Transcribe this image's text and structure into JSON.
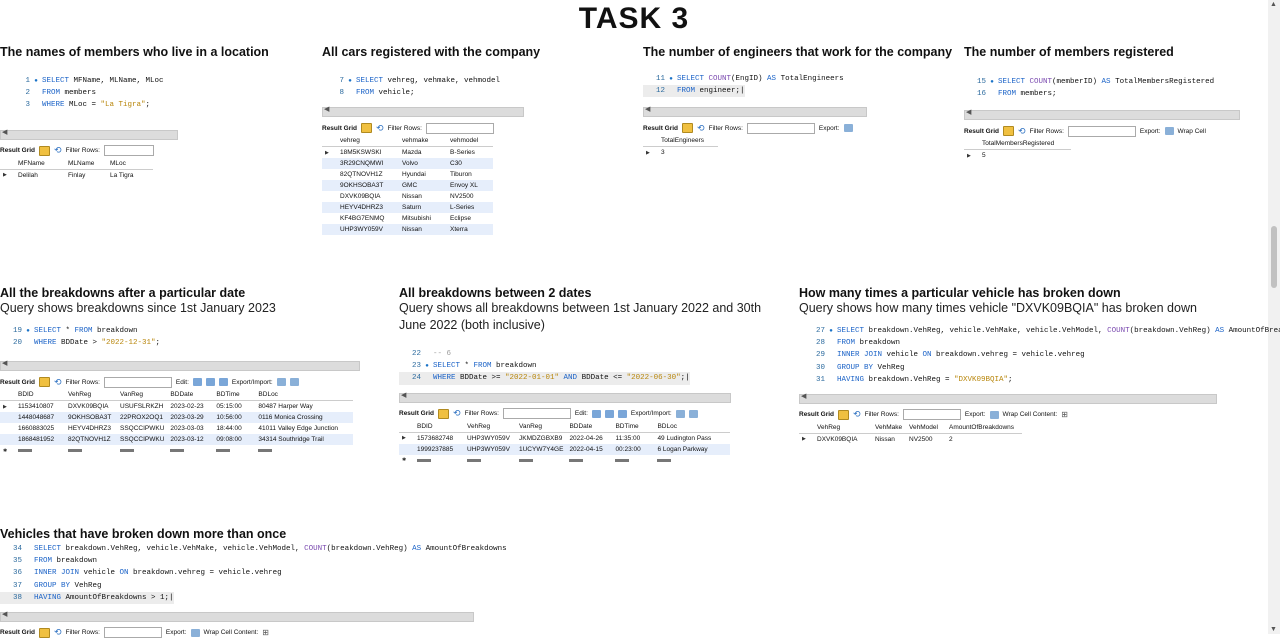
{
  "page": {
    "title": "TASK 3"
  },
  "panels": {
    "p1": {
      "title": "The names of members who live in a location",
      "code": [
        {
          "n": "1",
          "dot": true,
          "segs": [
            [
              "kw",
              "SELECT "
            ],
            [
              "",
              "MFName, MLName, MLoc"
            ]
          ]
        },
        {
          "n": "2",
          "dot": false,
          "segs": [
            [
              "kw",
              "FROM "
            ],
            [
              "",
              "members"
            ]
          ]
        },
        {
          "n": "3",
          "dot": false,
          "segs": [
            [
              "kw",
              "WHERE "
            ],
            [
              "",
              "MLoc = "
            ],
            [
              "st",
              "\"La Tigra\""
            ],
            [
              "",
              ";"
            ]
          ]
        }
      ],
      "toolbar": [
        "Result Grid",
        "Filter Rows:"
      ],
      "columns": [
        "MFName",
        "MLName",
        "MLoc"
      ],
      "rows": [
        [
          "Delilah",
          "Finlay",
          "La Tigra"
        ]
      ]
    },
    "p2": {
      "title": "All cars registered with the company",
      "code": [
        {
          "n": "7",
          "dot": true,
          "segs": [
            [
              "kw",
              "SELECT "
            ],
            [
              "",
              "vehreg, vehmake, vehmodel"
            ]
          ]
        },
        {
          "n": "8",
          "dot": false,
          "segs": [
            [
              "kw",
              "FROM "
            ],
            [
              "",
              "vehicle;"
            ]
          ]
        }
      ],
      "toolbar": [
        "Result Grid",
        "Filter Rows:"
      ],
      "columns": [
        "vehreg",
        "vehmake",
        "vehmodel"
      ],
      "rows": [
        [
          "18M5KSWSKI",
          "Mazda",
          "B-Series"
        ],
        [
          "3R29CNQMWI",
          "Volvo",
          "C30"
        ],
        [
          "82QTNOVH1Z",
          "Hyundai",
          "Tiburon"
        ],
        [
          "9OKHSOBA3T",
          "GMC",
          "Envoy XL"
        ],
        [
          "DXVK09BQIA",
          "Nissan",
          "NV2500"
        ],
        [
          "HEYV4DHRZ3",
          "Saturn",
          "L-Series"
        ],
        [
          "KF4BG7ENMQ",
          "Mitsubishi",
          "Eclipse"
        ],
        [
          "UHP3WY059V",
          "Nissan",
          "Xterra"
        ]
      ]
    },
    "p3": {
      "title": "The number of engineers that work for the company",
      "code": [
        {
          "n": "11",
          "dot": true,
          "segs": [
            [
              "kw",
              "SELECT "
            ],
            [
              "fn",
              "COUNT"
            ],
            [
              "",
              "(EngID) "
            ],
            [
              "kw",
              "AS "
            ],
            [
              "",
              "TotalEngineers"
            ]
          ]
        },
        {
          "n": "12",
          "dot": false,
          "cur": true,
          "segs": [
            [
              "kw",
              "FROM "
            ],
            [
              "",
              "engineer;"
            ]
          ]
        }
      ],
      "toolbar": [
        "Result Grid",
        "Filter Rows:",
        "Export:"
      ],
      "columns": [
        "TotalEngineers"
      ],
      "rows": [
        [
          "3"
        ]
      ]
    },
    "p4": {
      "title": "The number of members registered",
      "code": [
        {
          "n": "15",
          "dot": true,
          "segs": [
            [
              "kw",
              "SELECT "
            ],
            [
              "fn",
              "COUNT"
            ],
            [
              "",
              "(memberID) "
            ],
            [
              "kw",
              "AS "
            ],
            [
              "",
              "TotalMembersRegistered"
            ]
          ]
        },
        {
          "n": "16",
          "dot": false,
          "segs": [
            [
              "kw",
              "FROM "
            ],
            [
              "",
              "members;"
            ]
          ]
        }
      ],
      "toolbar": [
        "Result Grid",
        "Filter Rows:",
        "Export:",
        "Wrap Cell"
      ],
      "columns": [
        "TotalMembersRegistered"
      ],
      "rows": [
        [
          "5"
        ]
      ]
    },
    "p5": {
      "title": "All the breakdowns after a particular date",
      "subtitle": "Query shows breakdowns since 1st January 2023",
      "code": [
        {
          "n": "19",
          "dot": true,
          "segs": [
            [
              "kw",
              "SELECT "
            ],
            [
              "",
              "* "
            ],
            [
              "kw",
              "FROM "
            ],
            [
              "",
              "breakdown"
            ]
          ]
        },
        {
          "n": "20",
          "dot": false,
          "segs": [
            [
              "kw",
              "WHERE "
            ],
            [
              "",
              "BDDate > "
            ],
            [
              "st",
              "\"2022-12-31\""
            ],
            [
              "",
              ";"
            ]
          ]
        }
      ],
      "toolbar": [
        "Result Grid",
        "Filter Rows:",
        "Edit:",
        "Export/Import:"
      ],
      "columns": [
        "BDID",
        "VehReg",
        "VanReg",
        "BDDate",
        "BDTime",
        "BDLoc"
      ],
      "rows": [
        [
          "1153410807",
          "DXVK09BQIA",
          "USUFSLRKZH",
          "2023-02-23",
          "05:15:00",
          "80487 Harper Way"
        ],
        [
          "1448048687",
          "9OKHSOBA3T",
          "22PROX2OQ1",
          "2023-03-29",
          "10:56:00",
          "0116 Monica Crossing"
        ],
        [
          "1660883025",
          "HEYV4DHRZ3",
          "SSQCCIPWKU",
          "2023-03-03",
          "18:44:00",
          "41011 Valley Edge Junction"
        ],
        [
          "1868481952",
          "82QTNOVH1Z",
          "SSQCCIPWKU",
          "2023-03-12",
          "09:08:00",
          "34314 Southridge Trail"
        ]
      ]
    },
    "p6": {
      "title": "All breakdowns between 2 dates",
      "subtitle": "Query shows all breakdowns between 1st January 2022 and 30th June 2022 (both inclusive)",
      "code": [
        {
          "n": "22",
          "dot": false,
          "segs": [
            [
              "cm",
              "-- 6"
            ]
          ]
        },
        {
          "n": "23",
          "dot": true,
          "segs": [
            [
              "kw",
              "SELECT "
            ],
            [
              "",
              "* "
            ],
            [
              "kw",
              "FROM "
            ],
            [
              "",
              "breakdown"
            ]
          ]
        },
        {
          "n": "24",
          "dot": false,
          "cur": true,
          "segs": [
            [
              "kw",
              "WHERE "
            ],
            [
              "",
              "BDDate >= "
            ],
            [
              "st",
              "\"2022-01-01\""
            ],
            [
              "kw",
              " AND "
            ],
            [
              "",
              "BDDate <= "
            ],
            [
              "st",
              "\"2022-06-30\""
            ],
            [
              "",
              ";"
            ]
          ]
        }
      ],
      "toolbar": [
        "Result Grid",
        "Filter Rows:",
        "Edit:",
        "Export/Import:"
      ],
      "columns": [
        "BDID",
        "VehReg",
        "VanReg",
        "BDDate",
        "BDTime",
        "BDLoc"
      ],
      "rows": [
        [
          "1573682748",
          "UHP3WY059V",
          "JKMDZGBXB9",
          "2022-04-26",
          "11:35:00",
          "49 Ludington Pass"
        ],
        [
          "1999237885",
          "UHP3WY059V",
          "1UCYW7Y4GE",
          "2022-04-15",
          "00:23:00",
          "6 Logan Parkway"
        ]
      ]
    },
    "p7": {
      "title": "How many times a particular vehicle has broken down",
      "subtitle": "Query shows how many times vehicle \"DXVK09BQIA\" has broken down",
      "code": [
        {
          "n": "27",
          "dot": true,
          "segs": [
            [
              "kw",
              "SELECT "
            ],
            [
              "",
              "breakdown.VehReg, vehicle.VehMake, vehicle.VehModel, "
            ],
            [
              "fn",
              "COUNT"
            ],
            [
              "",
              "(breakdown.VehReg) "
            ],
            [
              "kw",
              "AS "
            ],
            [
              "",
              "AmountOfBreakdowns"
            ]
          ]
        },
        {
          "n": "28",
          "dot": false,
          "segs": [
            [
              "kw",
              "FROM "
            ],
            [
              "",
              "breakdown"
            ]
          ]
        },
        {
          "n": "29",
          "dot": false,
          "segs": [
            [
              "kw",
              "INNER JOIN "
            ],
            [
              "",
              "vehicle "
            ],
            [
              "kw",
              "ON "
            ],
            [
              "",
              "breakdown.vehreg = vehicle.vehreg"
            ]
          ]
        },
        {
          "n": "30",
          "dot": false,
          "segs": [
            [
              "kw",
              "GROUP BY "
            ],
            [
              "",
              "VehReg"
            ]
          ]
        },
        {
          "n": "31",
          "dot": false,
          "segs": [
            [
              "kw",
              "HAVING "
            ],
            [
              "",
              "breakdown.VehReg = "
            ],
            [
              "st",
              "\"DXVK09BQIA\""
            ],
            [
              "",
              ";"
            ]
          ]
        }
      ],
      "toolbar": [
        "Result Grid",
        "Filter Rows:",
        "Export:",
        "Wrap Cell Content:"
      ],
      "columns": [
        "VehReg",
        "VehMake",
        "VehModel",
        "AmountOfBreakdowns"
      ],
      "rows": [
        [
          "DXVK09BQIA",
          "Nissan",
          "NV2500",
          "2"
        ]
      ]
    },
    "p8": {
      "title": "Vehicles that have broken down more than once",
      "code": [
        {
          "n": "34",
          "dot": false,
          "segs": [
            [
              "kw",
              "SELECT "
            ],
            [
              "",
              "breakdown.VehReg, vehicle.VehMake, vehicle.VehModel, "
            ],
            [
              "fn",
              "COUNT"
            ],
            [
              "",
              "(breakdown.VehReg) "
            ],
            [
              "kw",
              "AS "
            ],
            [
              "",
              "AmountOfBreakdowns"
            ]
          ]
        },
        {
          "n": "35",
          "dot": false,
          "segs": [
            [
              "kw",
              "FROM "
            ],
            [
              "",
              "breakdown"
            ]
          ]
        },
        {
          "n": "36",
          "dot": false,
          "segs": [
            [
              "kw",
              "INNER JOIN "
            ],
            [
              "",
              "vehicle "
            ],
            [
              "kw",
              "ON "
            ],
            [
              "",
              "breakdown.vehreg = vehicle.vehreg"
            ]
          ]
        },
        {
          "n": "37",
          "dot": false,
          "segs": [
            [
              "kw",
              "GROUP BY "
            ],
            [
              "",
              "VehReg"
            ]
          ]
        },
        {
          "n": "38",
          "dot": false,
          "cur": true,
          "segs": [
            [
              "kw",
              "HAVING "
            ],
            [
              "",
              "AmountOfBreakdowns > 1;"
            ]
          ]
        }
      ],
      "toolbar": [
        "Result Grid",
        "Filter Rows:",
        "Export:",
        "Wrap Cell Content:"
      ],
      "columns": [],
      "rows": []
    }
  }
}
